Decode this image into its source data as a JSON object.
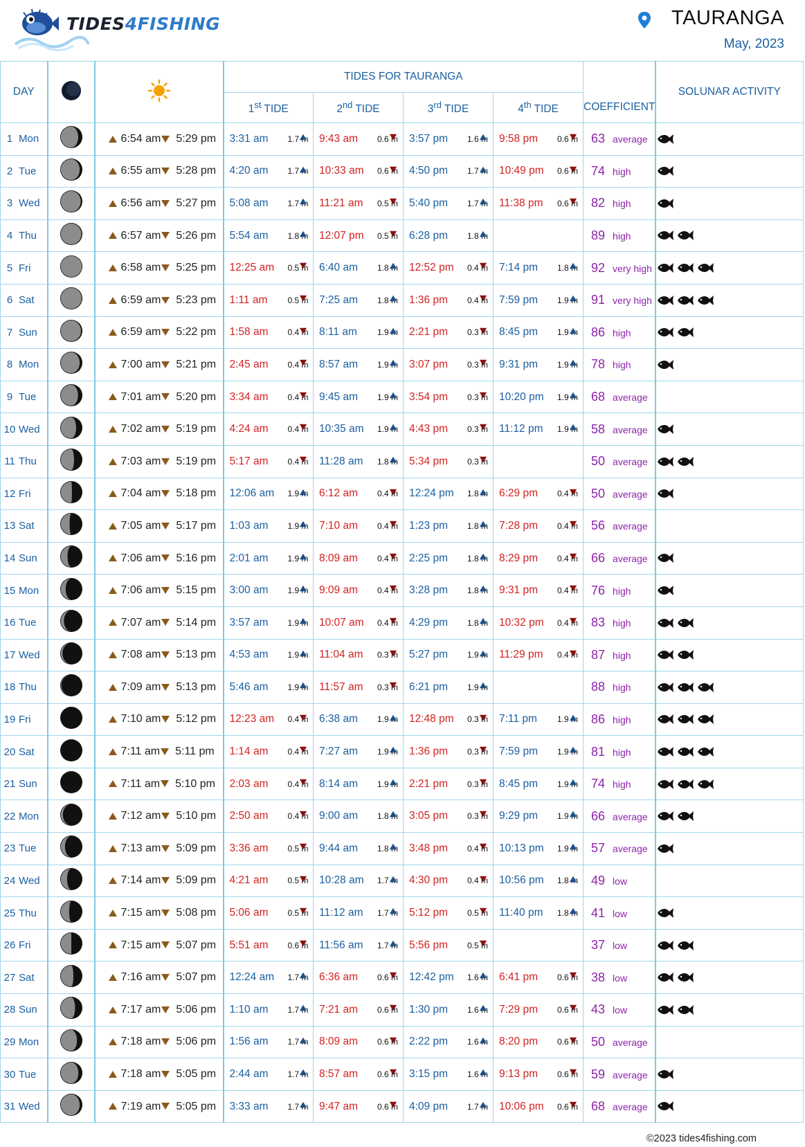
{
  "brand": {
    "part1": "TIDES",
    "part2": "4",
    "part3": "FISHING"
  },
  "location": {
    "name": "TAURANGA",
    "month": "May, 2023"
  },
  "table": {
    "col_day": "DAY",
    "col_tides_title": "TIDES FOR TAURANGA",
    "tide_headers": [
      {
        "num": "1",
        "sup": "st",
        "label": " TIDE"
      },
      {
        "num": "2",
        "sup": "nd",
        "label": " TIDE"
      },
      {
        "num": "3",
        "sup": "rd",
        "label": " TIDE"
      },
      {
        "num": "4",
        "sup": "th",
        "label": " TIDE"
      }
    ],
    "col_coef": "COEFFICIENT",
    "col_solunar": "SOLUNAR ACTIVITY"
  },
  "rows": [
    {
      "day": "1",
      "wd": "Mon",
      "moon": 0.83,
      "sr": "6:54 am",
      "ss": "5:29 pm",
      "tides": [
        {
          "t": "3:31 am",
          "h": "1.7 m",
          "d": "up"
        },
        {
          "t": "9:43 am",
          "h": "0.6 m",
          "d": "down"
        },
        {
          "t": "3:57 pm",
          "h": "1.6 m",
          "d": "up"
        },
        {
          "t": "9:58 pm",
          "h": "0.6 m",
          "d": "down"
        }
      ],
      "coef": "63",
      "lvl": "average",
      "fish": 1
    },
    {
      "day": "2",
      "wd": "Tue",
      "moon": 0.9,
      "sr": "6:55 am",
      "ss": "5:28 pm",
      "tides": [
        {
          "t": "4:20 am",
          "h": "1.7 m",
          "d": "up"
        },
        {
          "t": "10:33 am",
          "h": "0.6 m",
          "d": "down"
        },
        {
          "t": "4:50 pm",
          "h": "1.7 m",
          "d": "up"
        },
        {
          "t": "10:49 pm",
          "h": "0.6 m",
          "d": "down"
        }
      ],
      "coef": "74",
      "lvl": "high",
      "fish": 1
    },
    {
      "day": "3",
      "wd": "Wed",
      "moon": 0.95,
      "sr": "6:56 am",
      "ss": "5:27 pm",
      "tides": [
        {
          "t": "5:08 am",
          "h": "1.7 m",
          "d": "up"
        },
        {
          "t": "11:21 am",
          "h": "0.5 m",
          "d": "down"
        },
        {
          "t": "5:40 pm",
          "h": "1.7 m",
          "d": "up"
        },
        {
          "t": "11:38 pm",
          "h": "0.6 m",
          "d": "down"
        }
      ],
      "coef": "82",
      "lvl": "high",
      "fish": 1
    },
    {
      "day": "4",
      "wd": "Thu",
      "moon": 0.98,
      "sr": "6:57 am",
      "ss": "5:26 pm",
      "tides": [
        {
          "t": "5:54 am",
          "h": "1.8 m",
          "d": "up"
        },
        {
          "t": "12:07 pm",
          "h": "0.5 m",
          "d": "down"
        },
        {
          "t": "6:28 pm",
          "h": "1.8 m",
          "d": "up"
        },
        {
          "t": "",
          "h": "",
          "d": ""
        }
      ],
      "coef": "89",
      "lvl": "high",
      "fish": 2
    },
    {
      "day": "5",
      "wd": "Fri",
      "moon": 1.0,
      "sr": "6:58 am",
      "ss": "5:25 pm",
      "tides": [
        {
          "t": "12:25 am",
          "h": "0.5 m",
          "d": "down"
        },
        {
          "t": "6:40 am",
          "h": "1.8 m",
          "d": "up"
        },
        {
          "t": "12:52 pm",
          "h": "0.4 m",
          "d": "down"
        },
        {
          "t": "7:14 pm",
          "h": "1.8 m",
          "d": "up"
        }
      ],
      "coef": "92",
      "lvl": "very high",
      "fish": 3
    },
    {
      "day": "6",
      "wd": "Sat",
      "moon": 0.99,
      "sr": "6:59 am",
      "ss": "5:23 pm",
      "tides": [
        {
          "t": "1:11 am",
          "h": "0.5 m",
          "d": "down"
        },
        {
          "t": "7:25 am",
          "h": "1.8 m",
          "d": "up"
        },
        {
          "t": "1:36 pm",
          "h": "0.4 m",
          "d": "down"
        },
        {
          "t": "7:59 pm",
          "h": "1.9 m",
          "d": "up"
        }
      ],
      "coef": "91",
      "lvl": "very high",
      "fish": 3
    },
    {
      "day": "7",
      "wd": "Sun",
      "moon": 0.96,
      "sr": "6:59 am",
      "ss": "5:22 pm",
      "tides": [
        {
          "t": "1:58 am",
          "h": "0.4 m",
          "d": "down"
        },
        {
          "t": "8:11 am",
          "h": "1.9 m",
          "d": "up"
        },
        {
          "t": "2:21 pm",
          "h": "0.3 m",
          "d": "down"
        },
        {
          "t": "8:45 pm",
          "h": "1.9 m",
          "d": "up"
        }
      ],
      "coef": "86",
      "lvl": "high",
      "fish": 2
    },
    {
      "day": "8",
      "wd": "Mon",
      "moon": 0.9,
      "sr": "7:00 am",
      "ss": "5:21 pm",
      "tides": [
        {
          "t": "2:45 am",
          "h": "0.4 m",
          "d": "down"
        },
        {
          "t": "8:57 am",
          "h": "1.9 m",
          "d": "up"
        },
        {
          "t": "3:07 pm",
          "h": "0.3 m",
          "d": "down"
        },
        {
          "t": "9:31 pm",
          "h": "1.9 m",
          "d": "up"
        }
      ],
      "coef": "78",
      "lvl": "high",
      "fish": 1
    },
    {
      "day": "9",
      "wd": "Tue",
      "moon": 0.82,
      "sr": "7:01 am",
      "ss": "5:20 pm",
      "tides": [
        {
          "t": "3:34 am",
          "h": "0.4 m",
          "d": "down"
        },
        {
          "t": "9:45 am",
          "h": "1.9 m",
          "d": "up"
        },
        {
          "t": "3:54 pm",
          "h": "0.3 m",
          "d": "down"
        },
        {
          "t": "10:20 pm",
          "h": "1.9 m",
          "d": "up"
        }
      ],
      "coef": "68",
      "lvl": "average",
      "fish": 0
    },
    {
      "day": "10",
      "wd": "Wed",
      "moon": 0.73,
      "sr": "7:02 am",
      "ss": "5:19 pm",
      "tides": [
        {
          "t": "4:24 am",
          "h": "0.4 m",
          "d": "down"
        },
        {
          "t": "10:35 am",
          "h": "1.9 m",
          "d": "up"
        },
        {
          "t": "4:43 pm",
          "h": "0.3 m",
          "d": "down"
        },
        {
          "t": "11:12 pm",
          "h": "1.9 m",
          "d": "up"
        }
      ],
      "coef": "58",
      "lvl": "average",
      "fish": 1
    },
    {
      "day": "11",
      "wd": "Thu",
      "moon": 0.63,
      "sr": "7:03 am",
      "ss": "5:19 pm",
      "tides": [
        {
          "t": "5:17 am",
          "h": "0.4 m",
          "d": "down"
        },
        {
          "t": "11:28 am",
          "h": "1.8 m",
          "d": "up"
        },
        {
          "t": "5:34 pm",
          "h": "0.3 m",
          "d": "down"
        },
        {
          "t": "",
          "h": "",
          "d": ""
        }
      ],
      "coef": "50",
      "lvl": "average",
      "fish": 2
    },
    {
      "day": "12",
      "wd": "Fri",
      "moon": 0.53,
      "sr": "7:04 am",
      "ss": "5:18 pm",
      "tides": [
        {
          "t": "12:06 am",
          "h": "1.9 m",
          "d": "up"
        },
        {
          "t": "6:12 am",
          "h": "0.4 m",
          "d": "down"
        },
        {
          "t": "12:24 pm",
          "h": "1.8 m",
          "d": "up"
        },
        {
          "t": "6:29 pm",
          "h": "0.4 m",
          "d": "down"
        }
      ],
      "coef": "50",
      "lvl": "average",
      "fish": 1
    },
    {
      "day": "13",
      "wd": "Sat",
      "moon": 0.42,
      "sr": "7:05 am",
      "ss": "5:17 pm",
      "tides": [
        {
          "t": "1:03 am",
          "h": "1.9 m",
          "d": "up"
        },
        {
          "t": "7:10 am",
          "h": "0.4 m",
          "d": "down"
        },
        {
          "t": "1:23 pm",
          "h": "1.8 m",
          "d": "up"
        },
        {
          "t": "7:28 pm",
          "h": "0.4 m",
          "d": "down"
        }
      ],
      "coef": "56",
      "lvl": "average",
      "fish": 0
    },
    {
      "day": "14",
      "wd": "Sun",
      "moon": 0.32,
      "sr": "7:06 am",
      "ss": "5:16 pm",
      "tides": [
        {
          "t": "2:01 am",
          "h": "1.9 m",
          "d": "up"
        },
        {
          "t": "8:09 am",
          "h": "0.4 m",
          "d": "down"
        },
        {
          "t": "2:25 pm",
          "h": "1.8 m",
          "d": "up"
        },
        {
          "t": "8:29 pm",
          "h": "0.4 m",
          "d": "down"
        }
      ],
      "coef": "66",
      "lvl": "average",
      "fish": 1
    },
    {
      "day": "15",
      "wd": "Mon",
      "moon": 0.23,
      "sr": "7:06 am",
      "ss": "5:15 pm",
      "tides": [
        {
          "t": "3:00 am",
          "h": "1.9 m",
          "d": "up"
        },
        {
          "t": "9:09 am",
          "h": "0.4 m",
          "d": "down"
        },
        {
          "t": "3:28 pm",
          "h": "1.8 m",
          "d": "up"
        },
        {
          "t": "9:31 pm",
          "h": "0.4 m",
          "d": "down"
        }
      ],
      "coef": "76",
      "lvl": "high",
      "fish": 1
    },
    {
      "day": "16",
      "wd": "Tue",
      "moon": 0.15,
      "sr": "7:07 am",
      "ss": "5:14 pm",
      "tides": [
        {
          "t": "3:57 am",
          "h": "1.9 m",
          "d": "up"
        },
        {
          "t": "10:07 am",
          "h": "0.4 m",
          "d": "down"
        },
        {
          "t": "4:29 pm",
          "h": "1.8 m",
          "d": "up"
        },
        {
          "t": "10:32 pm",
          "h": "0.4 m",
          "d": "down"
        }
      ],
      "coef": "83",
      "lvl": "high",
      "fish": 2
    },
    {
      "day": "17",
      "wd": "Wed",
      "moon": 0.08,
      "sr": "7:08 am",
      "ss": "5:13 pm",
      "tides": [
        {
          "t": "4:53 am",
          "h": "1.9 m",
          "d": "up"
        },
        {
          "t": "11:04 am",
          "h": "0.3 m",
          "d": "down"
        },
        {
          "t": "5:27 pm",
          "h": "1.9 m",
          "d": "up"
        },
        {
          "t": "11:29 pm",
          "h": "0.4 m",
          "d": "down"
        }
      ],
      "coef": "87",
      "lvl": "high",
      "fish": 2
    },
    {
      "day": "18",
      "wd": "Thu",
      "moon": 0.03,
      "sr": "7:09 am",
      "ss": "5:13 pm",
      "tides": [
        {
          "t": "5:46 am",
          "h": "1.9 m",
          "d": "up"
        },
        {
          "t": "11:57 am",
          "h": "0.3 m",
          "d": "down"
        },
        {
          "t": "6:21 pm",
          "h": "1.9 m",
          "d": "up"
        },
        {
          "t": "",
          "h": "",
          "d": ""
        }
      ],
      "coef": "88",
      "lvl": "high",
      "fish": 3
    },
    {
      "day": "19",
      "wd": "Fri",
      "moon": 0.0,
      "sr": "7:10 am",
      "ss": "5:12 pm",
      "tides": [
        {
          "t": "12:23 am",
          "h": "0.4 m",
          "d": "down"
        },
        {
          "t": "6:38 am",
          "h": "1.9 m",
          "d": "up"
        },
        {
          "t": "12:48 pm",
          "h": "0.3 m",
          "d": "down"
        },
        {
          "t": "7:11 pm",
          "h": "1.9 m",
          "d": "up"
        }
      ],
      "coef": "86",
      "lvl": "high",
      "fish": 3
    },
    {
      "day": "20",
      "wd": "Sat",
      "moon": 0.0,
      "sr": "7:11 am",
      "ss": "5:11 pm",
      "tides": [
        {
          "t": "1:14 am",
          "h": "0.4 m",
          "d": "down"
        },
        {
          "t": "7:27 am",
          "h": "1.9 m",
          "d": "up"
        },
        {
          "t": "1:36 pm",
          "h": "0.3 m",
          "d": "down"
        },
        {
          "t": "7:59 pm",
          "h": "1.9 m",
          "d": "up"
        }
      ],
      "coef": "81",
      "lvl": "high",
      "fish": 3
    },
    {
      "day": "21",
      "wd": "Sun",
      "moon": 0.02,
      "sr": "7:11 am",
      "ss": "5:10 pm",
      "tides": [
        {
          "t": "2:03 am",
          "h": "0.4 m",
          "d": "down"
        },
        {
          "t": "8:14 am",
          "h": "1.9 m",
          "d": "up"
        },
        {
          "t": "2:21 pm",
          "h": "0.3 m",
          "d": "down"
        },
        {
          "t": "8:45 pm",
          "h": "1.9 m",
          "d": "up"
        }
      ],
      "coef": "74",
      "lvl": "high",
      "fish": 3
    },
    {
      "day": "22",
      "wd": "Mon",
      "moon": 0.1,
      "sr": "7:12 am",
      "ss": "5:10 pm",
      "tides": [
        {
          "t": "2:50 am",
          "h": "0.4 m",
          "d": "down"
        },
        {
          "t": "9:00 am",
          "h": "1.8 m",
          "d": "up"
        },
        {
          "t": "3:05 pm",
          "h": "0.3 m",
          "d": "down"
        },
        {
          "t": "9:29 pm",
          "h": "1.9 m",
          "d": "up"
        }
      ],
      "coef": "66",
      "lvl": "average",
      "fish": 2
    },
    {
      "day": "23",
      "wd": "Tue",
      "moon": 0.2,
      "sr": "7:13 am",
      "ss": "5:09 pm",
      "tides": [
        {
          "t": "3:36 am",
          "h": "0.5 m",
          "d": "down"
        },
        {
          "t": "9:44 am",
          "h": "1.8 m",
          "d": "up"
        },
        {
          "t": "3:48 pm",
          "h": "0.4 m",
          "d": "down"
        },
        {
          "t": "10:13 pm",
          "h": "1.9 m",
          "d": "up"
        }
      ],
      "coef": "57",
      "lvl": "average",
      "fish": 1
    },
    {
      "day": "24",
      "wd": "Wed",
      "moon": 0.3,
      "sr": "7:14 am",
      "ss": "5:09 pm",
      "tides": [
        {
          "t": "4:21 am",
          "h": "0.5 m",
          "d": "down"
        },
        {
          "t": "10:28 am",
          "h": "1.7 m",
          "d": "up"
        },
        {
          "t": "4:30 pm",
          "h": "0.4 m",
          "d": "down"
        },
        {
          "t": "10:56 pm",
          "h": "1.8 m",
          "d": "up"
        }
      ],
      "coef": "49",
      "lvl": "low",
      "fish": 0
    },
    {
      "day": "25",
      "wd": "Thu",
      "moon": 0.4,
      "sr": "7:15 am",
      "ss": "5:08 pm",
      "tides": [
        {
          "t": "5:06 am",
          "h": "0.5 m",
          "d": "down"
        },
        {
          "t": "11:12 am",
          "h": "1.7 m",
          "d": "up"
        },
        {
          "t": "5:12 pm",
          "h": "0.5 m",
          "d": "down"
        },
        {
          "t": "11:40 pm",
          "h": "1.8 m",
          "d": "up"
        }
      ],
      "coef": "41",
      "lvl": "low",
      "fish": 1
    },
    {
      "day": "26",
      "wd": "Fri",
      "moon": 0.5,
      "sr": "7:15 am",
      "ss": "5:07 pm",
      "tides": [
        {
          "t": "5:51 am",
          "h": "0.6 m",
          "d": "down"
        },
        {
          "t": "11:56 am",
          "h": "1.7 m",
          "d": "up"
        },
        {
          "t": "5:56 pm",
          "h": "0.5 m",
          "d": "down"
        },
        {
          "t": "",
          "h": "",
          "d": ""
        }
      ],
      "coef": "37",
      "lvl": "low",
      "fish": 2
    },
    {
      "day": "27",
      "wd": "Sat",
      "moon": 0.6,
      "sr": "7:16 am",
      "ss": "5:07 pm",
      "tides": [
        {
          "t": "12:24 am",
          "h": "1.7 m",
          "d": "up"
        },
        {
          "t": "6:36 am",
          "h": "0.6 m",
          "d": "down"
        },
        {
          "t": "12:42 pm",
          "h": "1.6 m",
          "d": "up"
        },
        {
          "t": "6:41 pm",
          "h": "0.6 m",
          "d": "down"
        }
      ],
      "coef": "38",
      "lvl": "low",
      "fish": 2
    },
    {
      "day": "28",
      "wd": "Sun",
      "moon": 0.68,
      "sr": "7:17 am",
      "ss": "5:06 pm",
      "tides": [
        {
          "t": "1:10 am",
          "h": "1.7 m",
          "d": "up"
        },
        {
          "t": "7:21 am",
          "h": "0.6 m",
          "d": "down"
        },
        {
          "t": "1:30 pm",
          "h": "1.6 m",
          "d": "up"
        },
        {
          "t": "7:29 pm",
          "h": "0.6 m",
          "d": "down"
        }
      ],
      "coef": "43",
      "lvl": "low",
      "fish": 2
    },
    {
      "day": "29",
      "wd": "Mon",
      "moon": 0.77,
      "sr": "7:18 am",
      "ss": "5:06 pm",
      "tides": [
        {
          "t": "1:56 am",
          "h": "1.7 m",
          "d": "up"
        },
        {
          "t": "8:09 am",
          "h": "0.6 m",
          "d": "down"
        },
        {
          "t": "2:22 pm",
          "h": "1.6 m",
          "d": "up"
        },
        {
          "t": "8:20 pm",
          "h": "0.6 m",
          "d": "down"
        }
      ],
      "coef": "50",
      "lvl": "average",
      "fish": 0
    },
    {
      "day": "30",
      "wd": "Tue",
      "moon": 0.84,
      "sr": "7:18 am",
      "ss": "5:05 pm",
      "tides": [
        {
          "t": "2:44 am",
          "h": "1.7 m",
          "d": "up"
        },
        {
          "t": "8:57 am",
          "h": "0.6 m",
          "d": "down"
        },
        {
          "t": "3:15 pm",
          "h": "1.6 m",
          "d": "up"
        },
        {
          "t": "9:13 pm",
          "h": "0.6 m",
          "d": "down"
        }
      ],
      "coef": "59",
      "lvl": "average",
      "fish": 1
    },
    {
      "day": "31",
      "wd": "Wed",
      "moon": 0.9,
      "sr": "7:19 am",
      "ss": "5:05 pm",
      "tides": [
        {
          "t": "3:33 am",
          "h": "1.7 m",
          "d": "up"
        },
        {
          "t": "9:47 am",
          "h": "0.6 m",
          "d": "down"
        },
        {
          "t": "4:09 pm",
          "h": "1.7 m",
          "d": "up"
        },
        {
          "t": "10:06 pm",
          "h": "0.6 m",
          "d": "down"
        }
      ],
      "coef": "68",
      "lvl": "average",
      "fish": 1
    }
  ],
  "footer": "©2023   tides4fishing.com"
}
